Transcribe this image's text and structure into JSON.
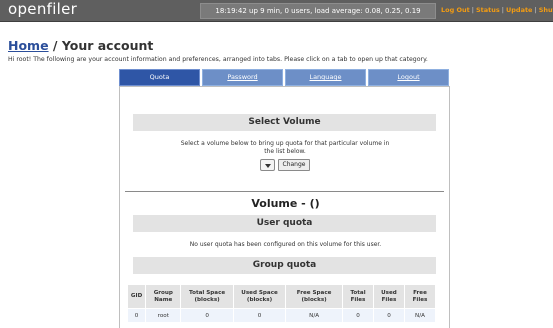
{
  "app": {
    "logo": "openfiler",
    "status": "18:19:42 up 9 min, 0 users, load average: 0.08, 0.25, 0.19",
    "links": [
      "Log Out",
      "Status",
      "Update",
      "Shutdown"
    ]
  },
  "breadcrumb": {
    "home": "Home",
    "separator": " / ",
    "current": "Your account"
  },
  "intro": "Hi root! The following are your account information and preferences, arranged into tabs. Please click on a tab to open up that category.",
  "tabs": [
    {
      "label": "Quota",
      "active": true
    },
    {
      "label": "Password",
      "active": false
    },
    {
      "label": "Language",
      "active": false
    },
    {
      "label": "Logout",
      "active": false
    }
  ],
  "select_volume": {
    "title": "Select Volume",
    "description": "Select a volume below to bring up quota for that particular volume in the list below.",
    "selected": "",
    "button": "Change"
  },
  "volume": {
    "title": "Volume - ()"
  },
  "user_quota": {
    "title": "User quota",
    "message": "No user quota has been configured on this volume for this user."
  },
  "group_quota": {
    "title": "Group quota",
    "columns": [
      "GID",
      "Group Name",
      "Total Space (blocks)",
      "Used Space (blocks)",
      "Free Space (blocks)",
      "Total Files",
      "Used Files",
      "Free Files"
    ],
    "rows": [
      [
        "0",
        "root",
        "0",
        "0",
        "N/A",
        "0",
        "0",
        "N/A"
      ]
    ]
  },
  "colors": {
    "topbar": "#5f5f5f",
    "link_orange": "#f39c12",
    "tab_active": "#2f56a6",
    "tab_inactive": "#6d8fc7",
    "heading_link": "#2b4e9a",
    "section_bar": "#e3e3e3"
  }
}
